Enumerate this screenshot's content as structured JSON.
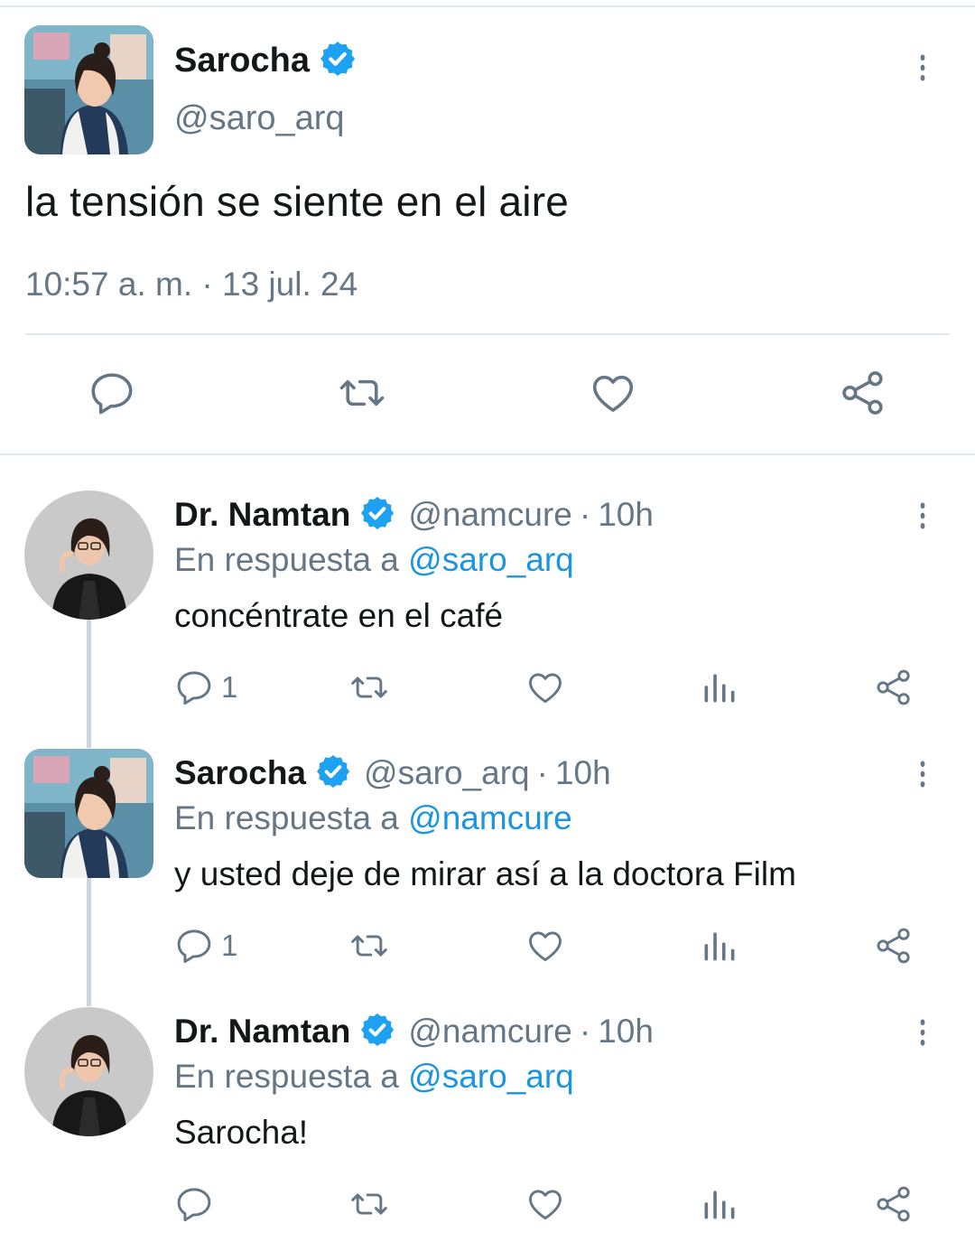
{
  "main_tweet": {
    "name": "Sarocha",
    "handle": "@saro_arq",
    "text": "la tensión se siente en el aire",
    "timestamp": "10:57 a. m. · 13 jul. 24",
    "avatar": "sarocha-avatar",
    "verified": true
  },
  "replies": [
    {
      "name": "Dr. Namtan",
      "handle": "@namcure",
      "separator": "·",
      "time": "10h",
      "reply_prefix": "En respuesta a",
      "reply_to": "@saro_arq",
      "text": "concéntrate en el café",
      "reply_count": "1",
      "avatar_shape": "round"
    },
    {
      "name": "Sarocha",
      "handle": "@saro_arq",
      "separator": "·",
      "time": "10h",
      "reply_prefix": "En respuesta a",
      "reply_to": "@namcure",
      "text": "y usted deje de mirar así a la doctora Film",
      "reply_count": "1",
      "avatar_shape": "square"
    },
    {
      "name": "Dr. Namtan",
      "handle": "@namcure",
      "separator": "·",
      "time": "10h",
      "reply_prefix": "En respuesta a",
      "reply_to": "@saro_arq",
      "text": "Sarocha!",
      "reply_count": "",
      "avatar_shape": "round"
    }
  ],
  "icons": {
    "reply": "reply-icon",
    "retweet": "retweet-icon",
    "like": "like-icon",
    "analytics": "analytics-icon",
    "share": "share-icon",
    "more": "more-vertical-icon",
    "verified": "verified-badge-icon"
  },
  "colors": {
    "link": "#1b95e0",
    "verified": "#1da1f2",
    "muted": "#657786",
    "text": "#14171a",
    "divider": "#e1e8ed",
    "thread_line": "#ccd6dd"
  }
}
